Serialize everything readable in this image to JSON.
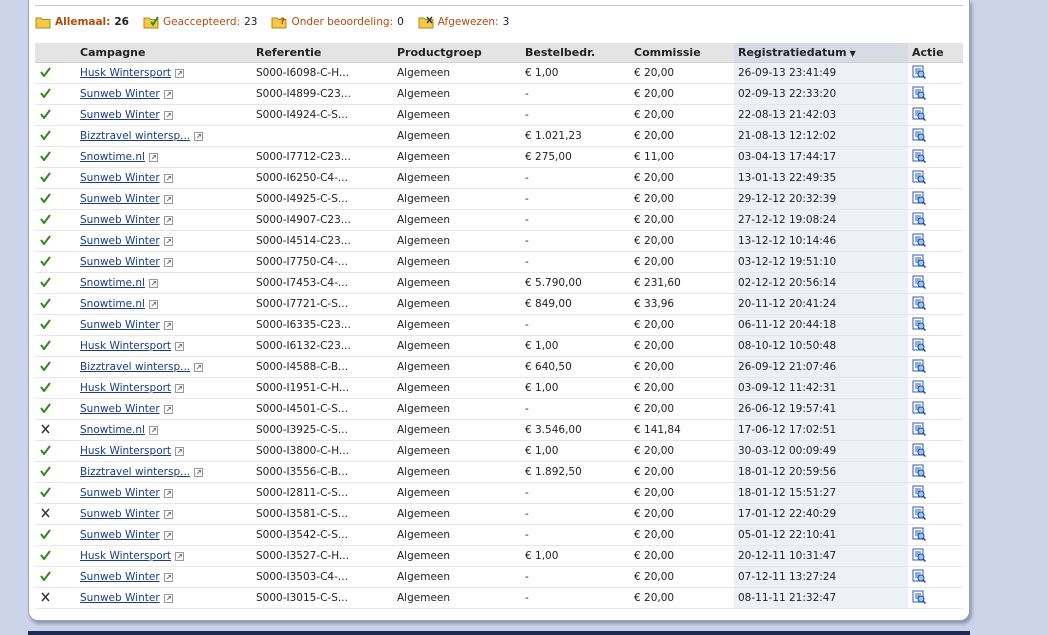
{
  "filters": [
    {
      "label": "Allemaal:",
      "count": "26",
      "icon": "folder-icon",
      "active": true
    },
    {
      "label": "Geaccepteerd:",
      "count": "23",
      "icon": "folder-check-icon",
      "active": false
    },
    {
      "label": "Onder beoordeling:",
      "count": "0",
      "icon": "folder-question-icon",
      "active": false
    },
    {
      "label": "Afgewezen:",
      "count": "3",
      "icon": "folder-cross-icon",
      "active": false
    }
  ],
  "columns": {
    "campagne": "Campagne",
    "referentie": "Referentie",
    "productgroep": "Productgroep",
    "bestelbedr": "Bestelbedr.",
    "commissie": "Commissie",
    "registratiedatum": "Registratiedatum",
    "actie": "Actie"
  },
  "colors": {
    "accepted": "#2e8b1e",
    "rejected": "#333333",
    "link": "#1a3c8a",
    "filter_label": "#b34b0b"
  },
  "rows": [
    {
      "status": "accepted",
      "campaign": "Husk Wintersport",
      "ref": "S000-I6098-C-H...",
      "group": "Algemeen",
      "amount": "€ 1,00",
      "commission": "€ 20,00",
      "date": "26-09-13 23:41:49"
    },
    {
      "status": "accepted",
      "campaign": "Sunweb Winter",
      "ref": "S000-I4899-C23...",
      "group": "Algemeen",
      "amount": "-",
      "commission": "€ 20,00",
      "date": "02-09-13 22:33:20"
    },
    {
      "status": "accepted",
      "campaign": "Sunweb Winter",
      "ref": "S000-I4924-C-S...",
      "group": "Algemeen",
      "amount": "-",
      "commission": "€ 20,00",
      "date": "22-08-13 21:42:03"
    },
    {
      "status": "accepted",
      "campaign": "Bizztravel wintersp...",
      "ref": "",
      "group": "Algemeen",
      "amount": "€ 1.021,23",
      "commission": "€ 20,00",
      "date": "21-08-13 12:12:02"
    },
    {
      "status": "accepted",
      "campaign": "Snowtime.nl",
      "ref": "S000-I7712-C23...",
      "group": "Algemeen",
      "amount": "€ 275,00",
      "commission": "€ 11,00",
      "date": "03-04-13 17:44:17"
    },
    {
      "status": "accepted",
      "campaign": "Sunweb Winter",
      "ref": "S000-I6250-C4-...",
      "group": "Algemeen",
      "amount": "-",
      "commission": "€ 20,00",
      "date": "13-01-13 22:49:35"
    },
    {
      "status": "accepted",
      "campaign": "Sunweb Winter",
      "ref": "S000-I4925-C-S...",
      "group": "Algemeen",
      "amount": "-",
      "commission": "€ 20,00",
      "date": "29-12-12 20:32:39"
    },
    {
      "status": "accepted",
      "campaign": "Sunweb Winter",
      "ref": "S000-I4907-C23...",
      "group": "Algemeen",
      "amount": "-",
      "commission": "€ 20,00",
      "date": "27-12-12 19:08:24"
    },
    {
      "status": "accepted",
      "campaign": "Sunweb Winter",
      "ref": "S000-I4514-C23...",
      "group": "Algemeen",
      "amount": "-",
      "commission": "€ 20,00",
      "date": "13-12-12 10:14:46"
    },
    {
      "status": "accepted",
      "campaign": "Sunweb Winter",
      "ref": "S000-I7750-C4-...",
      "group": "Algemeen",
      "amount": "-",
      "commission": "€ 20,00",
      "date": "03-12-12 19:51:10"
    },
    {
      "status": "accepted",
      "campaign": "Snowtime.nl",
      "ref": "S000-I7453-C4-...",
      "group": "Algemeen",
      "amount": "€ 5.790,00",
      "commission": "€ 231,60",
      "date": "02-12-12 20:56:14"
    },
    {
      "status": "accepted",
      "campaign": "Snowtime.nl",
      "ref": "S000-I7721-C-S...",
      "group": "Algemeen",
      "amount": "€ 849,00",
      "commission": "€ 33,96",
      "date": "20-11-12 20:41:24"
    },
    {
      "status": "accepted",
      "campaign": "Sunweb Winter",
      "ref": "S000-I6335-C23...",
      "group": "Algemeen",
      "amount": "-",
      "commission": "€ 20,00",
      "date": "06-11-12 20:44:18"
    },
    {
      "status": "accepted",
      "campaign": "Husk Wintersport",
      "ref": "S000-I6132-C23...",
      "group": "Algemeen",
      "amount": "€ 1,00",
      "commission": "€ 20,00",
      "date": "08-10-12 10:50:48"
    },
    {
      "status": "accepted",
      "campaign": "Bizztravel wintersp...",
      "ref": "S000-I4588-C-B...",
      "group": "Algemeen",
      "amount": "€ 640,50",
      "commission": "€ 20,00",
      "date": "26-09-12 21:07:46"
    },
    {
      "status": "accepted",
      "campaign": "Husk Wintersport",
      "ref": "S000-I1951-C-H...",
      "group": "Algemeen",
      "amount": "€ 1,00",
      "commission": "€ 20,00",
      "date": "03-09-12 11:42:31"
    },
    {
      "status": "accepted",
      "campaign": "Sunweb Winter",
      "ref": "S000-I4501-C-S...",
      "group": "Algemeen",
      "amount": "-",
      "commission": "€ 20,00",
      "date": "26-06-12 19:57:41"
    },
    {
      "status": "rejected",
      "campaign": "Snowtime.nl",
      "ref": "S000-I3925-C-S...",
      "group": "Algemeen",
      "amount": "€ 3.546,00",
      "commission": "€ 141,84",
      "date": "17-06-12 17:02:51"
    },
    {
      "status": "accepted",
      "campaign": "Husk Wintersport",
      "ref": "S000-I3800-C-H...",
      "group": "Algemeen",
      "amount": "€ 1,00",
      "commission": "€ 20,00",
      "date": "30-03-12 00:09:49"
    },
    {
      "status": "accepted",
      "campaign": "Bizztravel wintersp...",
      "ref": "S000-I3556-C-B...",
      "group": "Algemeen",
      "amount": "€ 1.892,50",
      "commission": "€ 20,00",
      "date": "18-01-12 20:59:56"
    },
    {
      "status": "accepted",
      "campaign": "Sunweb Winter",
      "ref": "S000-I2811-C-S...",
      "group": "Algemeen",
      "amount": "-",
      "commission": "€ 20,00",
      "date": "18-01-12 15:51:27"
    },
    {
      "status": "rejected",
      "campaign": "Sunweb Winter",
      "ref": "S000-I3581-C-S...",
      "group": "Algemeen",
      "amount": "-",
      "commission": "€ 20,00",
      "date": "17-01-12 22:40:29"
    },
    {
      "status": "accepted",
      "campaign": "Sunweb Winter",
      "ref": "S000-I3542-C-S...",
      "group": "Algemeen",
      "amount": "-",
      "commission": "€ 20,00",
      "date": "05-01-12 22:10:41"
    },
    {
      "status": "accepted",
      "campaign": "Husk Wintersport",
      "ref": "S000-I3527-C-H...",
      "group": "Algemeen",
      "amount": "€ 1,00",
      "commission": "€ 20,00",
      "date": "20-12-11 10:31:47"
    },
    {
      "status": "accepted",
      "campaign": "Sunweb Winter",
      "ref": "S000-I3503-C4-...",
      "group": "Algemeen",
      "amount": "-",
      "commission": "€ 20,00",
      "date": "07-12-11 13:27:24"
    },
    {
      "status": "rejected",
      "campaign": "Sunweb Winter",
      "ref": "S000-I3015-C-S...",
      "group": "Algemeen",
      "amount": "-",
      "commission": "€ 20,00",
      "date": "08-11-11 21:32:47"
    }
  ]
}
